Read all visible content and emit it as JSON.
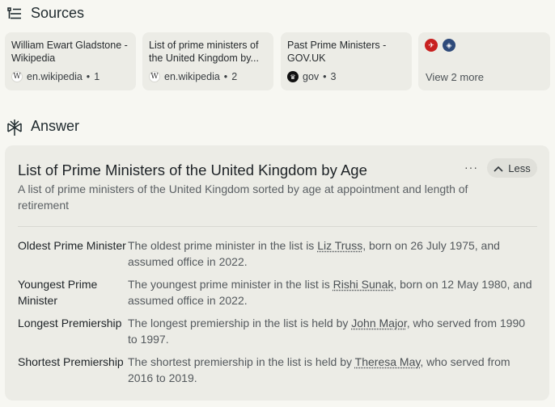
{
  "sources": {
    "heading": "Sources",
    "cards": [
      {
        "title": "William Ewart Gladstone - Wikipedia",
        "site": "en.wikipedia",
        "index": "1",
        "favicon": "W"
      },
      {
        "title": "List of prime ministers of the United Kingdom by...",
        "site": "en.wikipedia",
        "index": "2",
        "favicon": "W"
      },
      {
        "title": "Past Prime Ministers - GOV.UK",
        "site": "gov",
        "index": "3",
        "favicon": "crown"
      }
    ],
    "more_label": "View 2 more"
  },
  "answer": {
    "heading": "Answer",
    "title": "List of Prime Ministers of the United Kingdom by Age",
    "subtitle": "A list of prime ministers of the United Kingdom sorted by age at appointment and length of retirement",
    "more_label": "···",
    "less_label": "Less",
    "rows": [
      {
        "label": "Oldest Prime Minister",
        "pre": "The oldest prime minister in the list is ",
        "link": "Liz Truss",
        "post": ", born on 26 July 1975, and assumed office in 2022."
      },
      {
        "label": "Youngest Prime Minister",
        "pre": "The youngest prime minister in the list is ",
        "link": "Rishi Sunak",
        "post": ", born on 12 May 1980, and assumed office in 2022."
      },
      {
        "label": "Longest Premiership",
        "pre": "The longest premiership in the list is held by ",
        "link": "John Major",
        "post": ", who served from 1990 to 1997."
      },
      {
        "label": "Shortest Premiership",
        "pre": "The shortest premiership in the list is held by ",
        "link": "Theresa May",
        "post": ", who served from 2016 to 2019."
      }
    ]
  }
}
